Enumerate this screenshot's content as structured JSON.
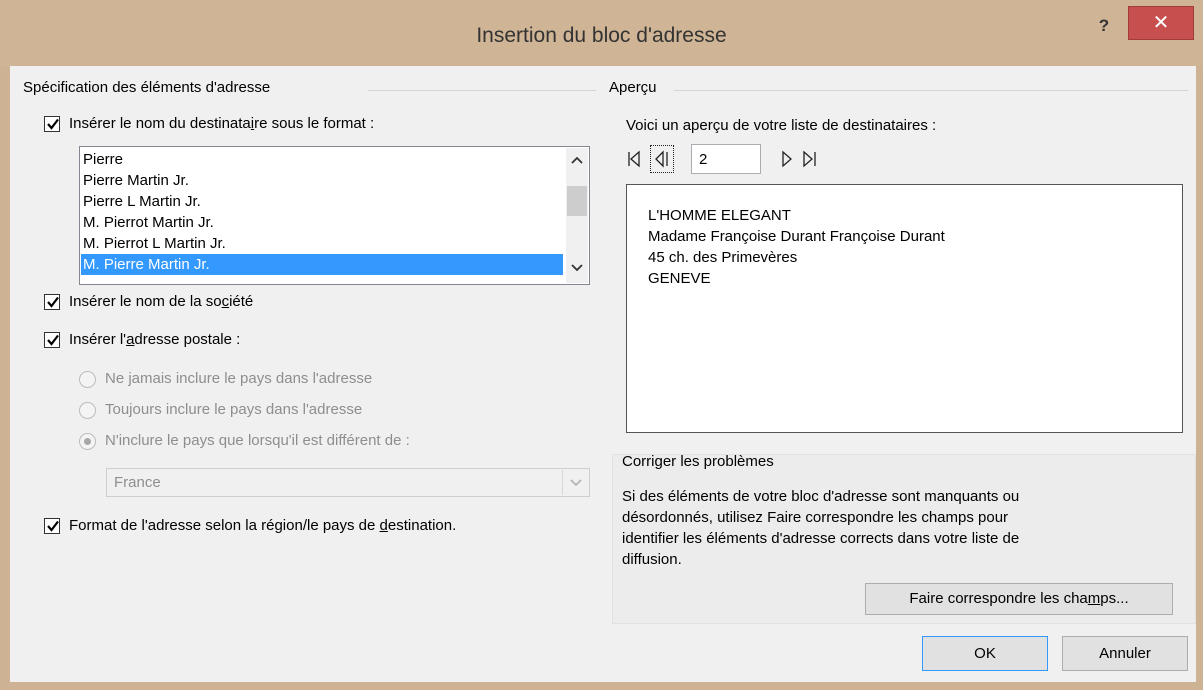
{
  "window": {
    "title": "Insertion du bloc d'adresse",
    "help_label": "?",
    "close_label": "✕"
  },
  "left": {
    "group_title": "Spécification des éléments d'adresse",
    "recipient_name": {
      "checked": true,
      "label_parts": [
        "Insérer le nom du destinata",
        "i",
        "re sous le format :"
      ]
    },
    "name_formats": [
      "Pierre",
      "Pierre Martin Jr.",
      "Pierre L Martin Jr.",
      "M. Pierrot Martin Jr.",
      "M. Pierrot L Martin Jr.",
      "M. Pierre Martin Jr."
    ],
    "selected_format": "M. Pierre Martin Jr.",
    "company": {
      "checked": true,
      "label_parts": [
        "Insérer le nom de la so",
        "c",
        "iété"
      ]
    },
    "postal": {
      "checked": true,
      "label_parts": [
        "Insérer l'",
        "a",
        "dresse postale :"
      ]
    },
    "country_options": {
      "never": "Ne jamais inclure le pays dans l'adresse",
      "always": "Toujours inclure le pays dans l'adresse",
      "if_different": "N'inclure le pays que lorsqu'il est différent de :",
      "selected": "if_different"
    },
    "country_value": "France",
    "region_format": {
      "checked": true,
      "label_parts": [
        "Format de l'adresse selon la région/le pays de ",
        "d",
        "estination."
      ]
    }
  },
  "right": {
    "group_title": "Aperçu",
    "preview_intro": "Voici un aperçu de votre liste de destinataires :",
    "record_number": "2",
    "preview_lines": [
      "L'HOMME ELEGANT",
      "Madame Françoise Durant Françoise Durant",
      "45 ch. des Primevères",
      "GENEVE"
    ],
    "fix": {
      "group_title": "Corriger les problèmes",
      "lines": [
        "Si des éléments de votre bloc d'adresse sont manquants ou",
        "désordonnés, utilisez Faire correspondre les champs pour",
        "identifier les éléments d'adresse corrects dans votre liste de",
        "diffusion."
      ],
      "match_button_parts": [
        "Faire correspondre les cha",
        "m",
        "ps..."
      ]
    }
  },
  "footer": {
    "ok_label": "OK",
    "cancel_label": "Annuler"
  }
}
